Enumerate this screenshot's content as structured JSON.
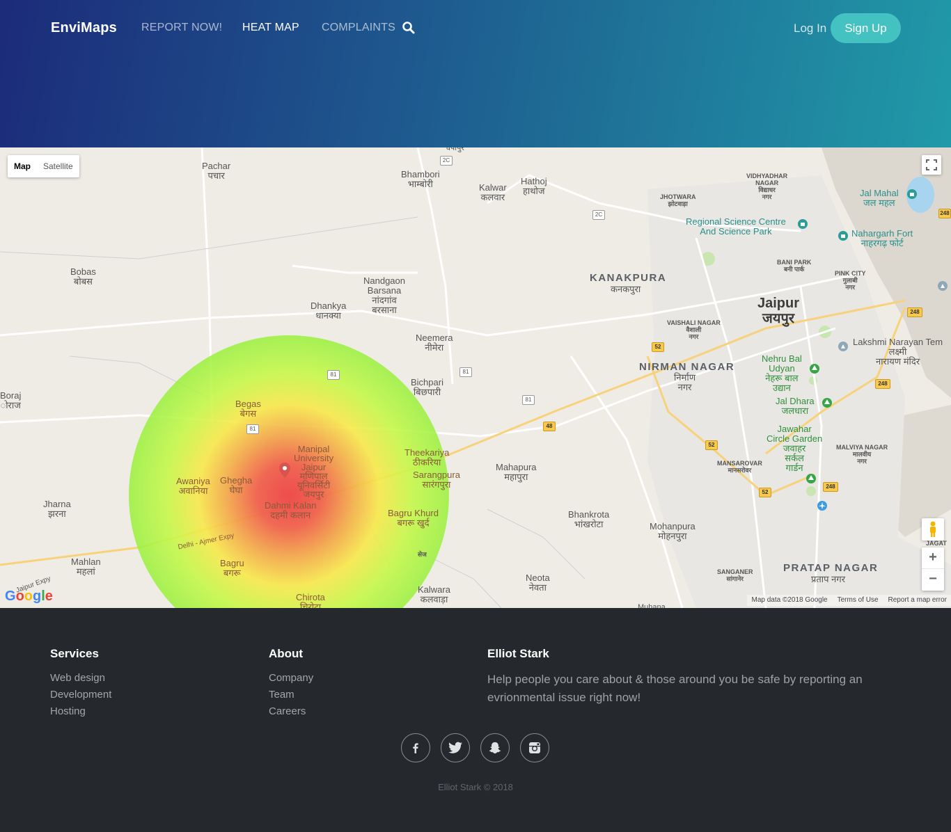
{
  "header": {
    "brand": "EnviMaps",
    "nav": [
      "REPORT NOW!",
      "HEAT MAP",
      "COMPLAINTS"
    ],
    "active_nav": "HEAT MAP",
    "login": "Log In",
    "signup": "Sign Up"
  },
  "map": {
    "map_type": [
      "Map",
      "Satellite"
    ],
    "selected_type": "Map",
    "labels": {
      "pachar": "Pachar\nपचार",
      "bhambori": "Bhambori\nभाम्बोरी",
      "kalwar": "Kalwar\nकलवार",
      "hathoj": "Hathoj\nहाथोज",
      "jhotwara": "JHOTWARA\nझोटवाड़ा",
      "vidhyadhar": "VIDHYADHAR\nNAGAR\nविद्याधर\nनगर",
      "jal_mahal": "Jal Mahal\nजल महल",
      "regional_science": "Regional Science Centre\nAnd Science Park",
      "nahargarh": "Nahargarh Fort\nनाहरगढ़ फोर्ट",
      "bobas": "Bobas\nबोबस",
      "nandgaon": "Nandgaon\nBarsana\nनांदगांव\nबरसाना",
      "kanakpura": "KANAKPURA",
      "kanakpura_hi": "कनकपुरा",
      "bani_park": "BANI PARK\nबनी पार्क",
      "pink_city": "PINK CITY\nगुलाबी\nनगर",
      "dhankya": "Dhankya\nधानक्या",
      "jaipur": "Jaipur\nजयपुर",
      "vaishali": "VAISHALI NAGAR\nवैशाली\nनगर",
      "neemera": "Neemera\nनीमेरा",
      "lakshmi": "Lakshmi Narayan Tem\nलक्ष्मी\nनारायण मंदिर",
      "nirman": "NIRMAN NAGAR",
      "nirman_hi": "निर्माण\nनगर",
      "nehru": "Nehru Bal\nUdyan\nनेहरू बाल\nउद्यान",
      "bichpari": "Bichpari\nबिछपारी",
      "boraj": "Boraj\nोराज",
      "begas": "Begas\nबेगस",
      "jal_dhara": "Jal Dhara\nजलधारा",
      "jawahar": "Jawahar\nCircle Garden\nजवाहर\nसर्कल\nगार्डन",
      "malviya": "MALVIYA NAGAR\nमालवीय\nनगर",
      "manipal": "Manipal\nUniversity\nJaipur\nमणिपाल\nयूनिवर्सिटी\nजयपुर",
      "theekariya": "Theekariya\nठीकरिया",
      "sarangpura": "Sarangpura\nसारंगपुरा",
      "mahapura": "Mahapura\nमहापुरा",
      "mansarovar": "MANSAROVAR\nमानसरोवर",
      "awaniya": "Awaniya\nअवानिया",
      "ghegha": "Ghegha\nघेघा",
      "jharna": "Jharna\nझरना",
      "dahmi": "Dahmi Kalan\nदहमी कलान",
      "bagru_khurd": "Bagru Khurd\nबगरू खुर्द",
      "bhankrota": "Bhankrota\nभांखरोटा",
      "mohanpura": "Mohanpura\nमोहनपुरा",
      "jagat": "JAGAT\nजतु",
      "delhi_ajmer": "Delhi - Ajmer Expy",
      "mahlan": "Mahlan\nमहलां",
      "bagru": "Bagru\nबगरू",
      "sej": "सेज",
      "sanganer": "SANGANER\nसांगानेर",
      "pratap": "PRATAP NAGAR",
      "pratap_hi": "प्रताप नगर",
      "neota": "Neota\nनेवता",
      "jaipur_expy": "Jaipur Expy",
      "kalwara": "Kalwara\nकलवाड़ा",
      "chirota": "Chirota\nचिरोटा",
      "muhana": "Muhana",
      "top_cut": "चंपापुर"
    },
    "shields": {
      "r2c_a": "2C",
      "r2c_b": "2C",
      "r81_a": "81",
      "r81_b": "81",
      "r81_c": "81",
      "r81_d": "81",
      "r52_a": "52",
      "r52_b": "52",
      "r52_c": "52",
      "r48": "48",
      "r248_a": "248",
      "r248_b": "248",
      "r248_c": "248",
      "r248_d": "248"
    },
    "zoom_in": "+",
    "zoom_out": "−",
    "google_logo": "Google",
    "attribution": [
      "Map data ©2018 Google",
      "Terms of Use",
      "Report a map error"
    ]
  },
  "footer": {
    "services": {
      "title": "Services",
      "links": [
        "Web design",
        "Development",
        "Hosting"
      ]
    },
    "about": {
      "title": "About",
      "links": [
        "Company",
        "Team",
        "Careers"
      ]
    },
    "owner": {
      "title": "Elliot Stark",
      "text": "Help people you care about & those around you be safe by reporting an evrionmental issue right now!"
    },
    "social_icons": [
      "facebook-icon",
      "twitter-icon",
      "snapchat-icon",
      "instagram-icon"
    ],
    "copyright": "Elliot Stark © 2018"
  }
}
